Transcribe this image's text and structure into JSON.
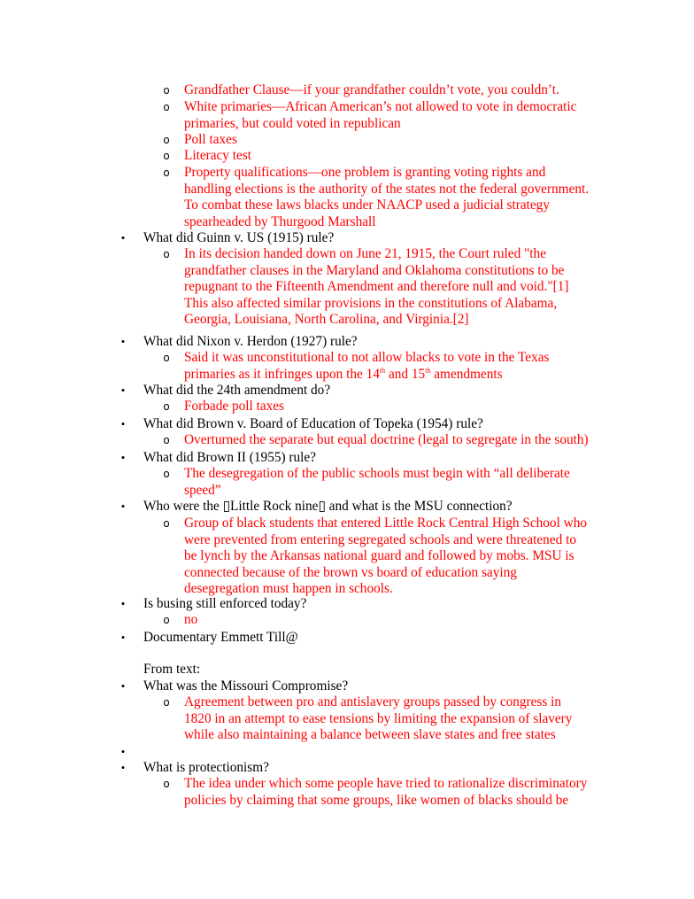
{
  "document": {
    "items": [
      {
        "type": "answer",
        "lines": [
          "Grandfather Clause—if your grandfather couldn’t vote, you couldn’t."
        ]
      },
      {
        "type": "answer",
        "lines": [
          "White primaries—African American’s not allowed to vote in democratic",
          "primaries, but could voted in republican"
        ]
      },
      {
        "type": "answer",
        "lines": [
          "Poll taxes"
        ]
      },
      {
        "type": "answer",
        "lines": [
          "Literacy test"
        ]
      },
      {
        "type": "answer",
        "lines": [
          "Property qualifications—one problem is granting voting rights and",
          "handling elections is the authority of the states not the federal government.",
          "To combat these laws blacks under NAACP used a judicial strategy",
          "spearheaded by Thurgood Marshall"
        ]
      },
      {
        "type": "question",
        "lines": [
          "What did Guinn v. US (1915) rule?"
        ]
      },
      {
        "type": "answer",
        "lines": [
          "In its decision handed down on June 21, 1915, the Court ruled \"the",
          "grandfather clauses in the Maryland and Oklahoma constitutions to be",
          "repugnant to the Fifteenth Amendment and therefore null and void.\"[1]",
          "This also affected similar provisions in the constitutions of Alabama,",
          "Georgia, Louisiana, North Carolina, and Virginia.[2]"
        ]
      },
      {
        "type": "question",
        "lines": [
          "What did Nixon v. Herdon (1927) rule?"
        ]
      },
      {
        "type": "answer",
        "lines": [
          "Said it was unconstitutional to not allow blacks to vote in the Texas"
        ],
        "extra": {
          "pre": "primaries as it infringes upon the 14",
          "sup1": "th",
          "mid": " and 15",
          "sup2": "th",
          "post": " amendments"
        }
      },
      {
        "type": "question",
        "lines": [
          "What did the 24th amendment do?"
        ]
      },
      {
        "type": "answer",
        "lines": [
          "Forbade poll taxes"
        ]
      },
      {
        "type": "question",
        "lines": [
          "What did Brown v. Board of Education of Topeka (1954) rule?"
        ]
      },
      {
        "type": "answer",
        "lines": [
          "Overturned the separate but equal doctrine (legal to segregate in the south)"
        ]
      },
      {
        "type": "question",
        "lines": [
          "What did Brown II (1955) rule?"
        ]
      },
      {
        "type": "answer",
        "lines": [
          "The desegregation of the public schools must begin with “all deliberate",
          "speed”"
        ]
      },
      {
        "type": "question",
        "lines": [
          "Who were the ▯Little Rock nine▯ and what is the MSU connection?"
        ]
      },
      {
        "type": "answer",
        "lines": [
          "Group of black students that entered Little Rock Central High School who",
          "were prevented from entering segregated schools and were threatened to",
          "be lynch by the Arkansas national guard and followed by mobs.  MSU is",
          "connected because of the brown vs board of education saying",
          "desegregation must happen in schools."
        ]
      },
      {
        "type": "question",
        "lines": [
          "Is busing still enforced today?"
        ]
      },
      {
        "type": "answer",
        "lines": [
          "no"
        ]
      },
      {
        "type": "question",
        "lines": [
          "Documentary Emmett Till@"
        ]
      },
      {
        "type": "plain",
        "lines": [
          "From text:"
        ]
      },
      {
        "type": "question",
        "lines": [
          "What was the Missouri Compromise?"
        ]
      },
      {
        "type": "answer",
        "lines": [
          "Agreement between pro and antislavery groups passed by congress in",
          "1820 in an attempt to ease tensions by limiting the expansion of slavery",
          "while also maintaining a balance between slave states and free states"
        ]
      },
      {
        "type": "question",
        "lines": [
          ""
        ]
      },
      {
        "type": "question",
        "lines": [
          "What is protectionism?"
        ]
      },
      {
        "type": "answer",
        "lines": [
          "The idea under which some people have tried to rationalize discriminatory",
          "policies by claiming that some groups, like women of blacks should be"
        ]
      }
    ],
    "bullet_glyph": "•",
    "sub_bullet_glyph": "o",
    "colors": {
      "question": "#000000",
      "answer": "#ff0000"
    }
  }
}
